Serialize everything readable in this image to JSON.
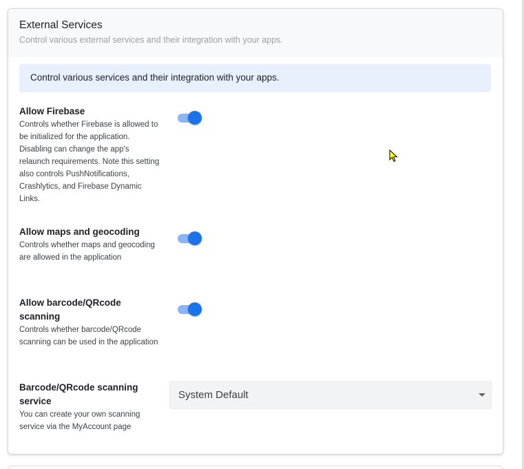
{
  "section": {
    "title": "External Services",
    "subtitle": "Control various external services and their integration with your apps."
  },
  "info_banner": {
    "text": "Control various services and their integration with your apps."
  },
  "settings": [
    {
      "label": "Allow Firebase",
      "description": "Controls whether Firebase is allowed to be initialized for the application. Disabling can change the app's relaunch requirements. Note this setting also controls PushNotifications, Crashlytics, and Firebase Dynamic Links.",
      "enabled": true
    },
    {
      "label": "Allow maps and geocoding",
      "description": "Controls whether maps and geocoding are allowed in the application",
      "enabled": true
    },
    {
      "label": "Allow barcode/QRcode scanning",
      "description": "Controls whether barcode/QRcode scanning can be used in the application",
      "enabled": true
    },
    {
      "label": "Barcode/QRcode scanning service",
      "description": "You can create your own scanning service via the MyAccount page",
      "selected_value": "System Default"
    }
  ],
  "colors": {
    "toggle_on_knob": "#1a73e8",
    "toggle_on_track": "#8ab4f8",
    "banner_bg": "#e8f0fe"
  },
  "icons": {
    "select_caret": "caret-down-icon",
    "cursor": "mouse-pointer-icon"
  }
}
